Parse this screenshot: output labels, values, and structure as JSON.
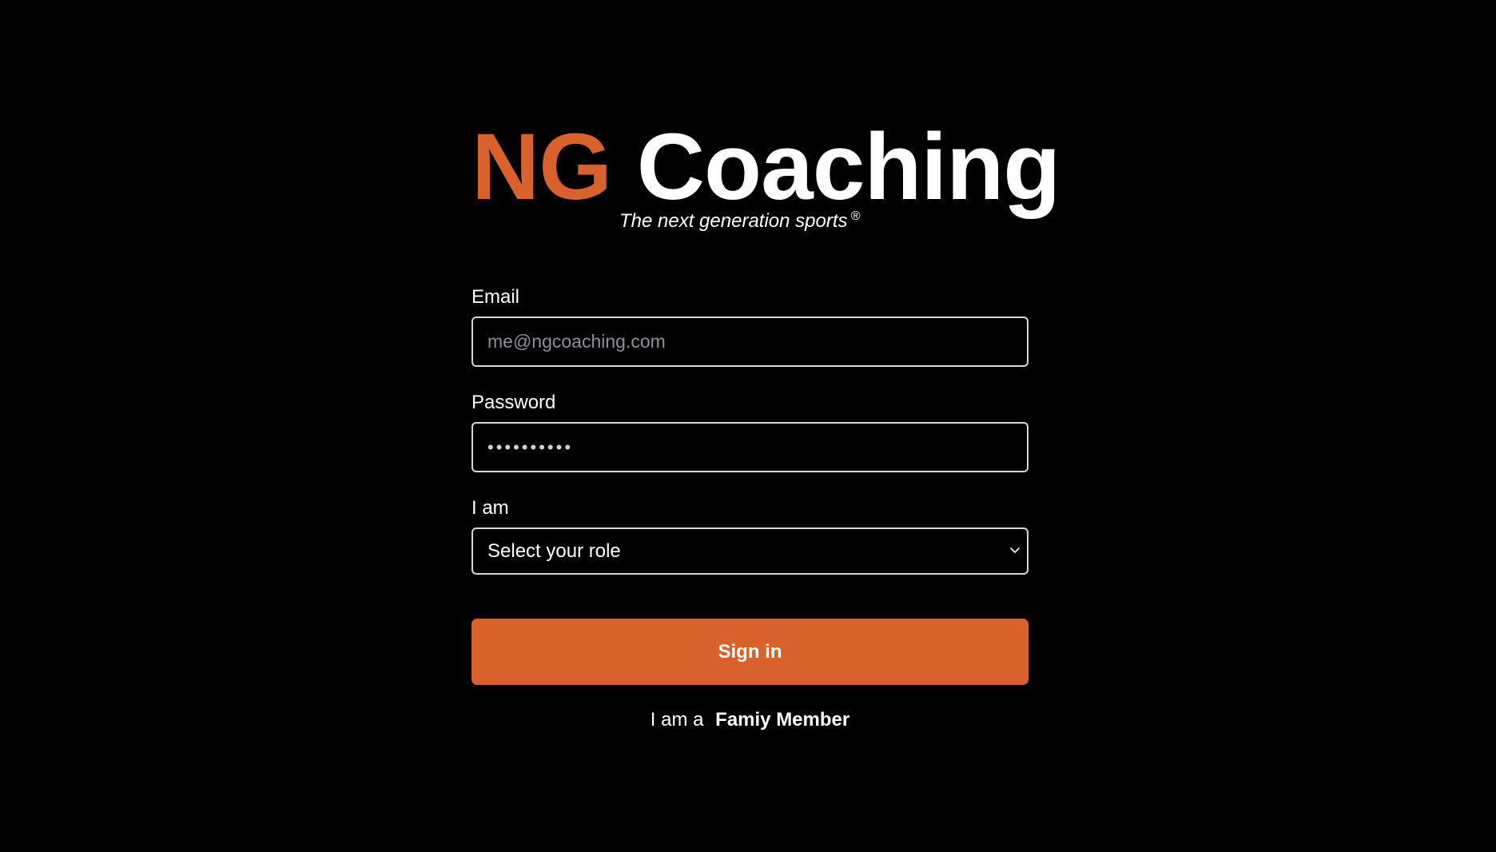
{
  "brand": {
    "name_part1": "NG",
    "name_part2": "Coaching",
    "tagline": "The next generation sports",
    "registered_mark": "®"
  },
  "form": {
    "email": {
      "label": "Email",
      "placeholder": "me@ngcoaching.com",
      "value": ""
    },
    "password": {
      "label": "Password",
      "masked_value": "••••••••••"
    },
    "role": {
      "label": "I am",
      "selected_value": "Select your role"
    },
    "signin_label": "Sign in",
    "family_prefix": "I am a",
    "family_link": "Famiy Member"
  },
  "colors": {
    "accent": "#d9612c",
    "background": "#000000",
    "text": "#ffffff",
    "border": "#d6d6d6"
  },
  "icons": {
    "role_select": "chevron-down-icon"
  }
}
